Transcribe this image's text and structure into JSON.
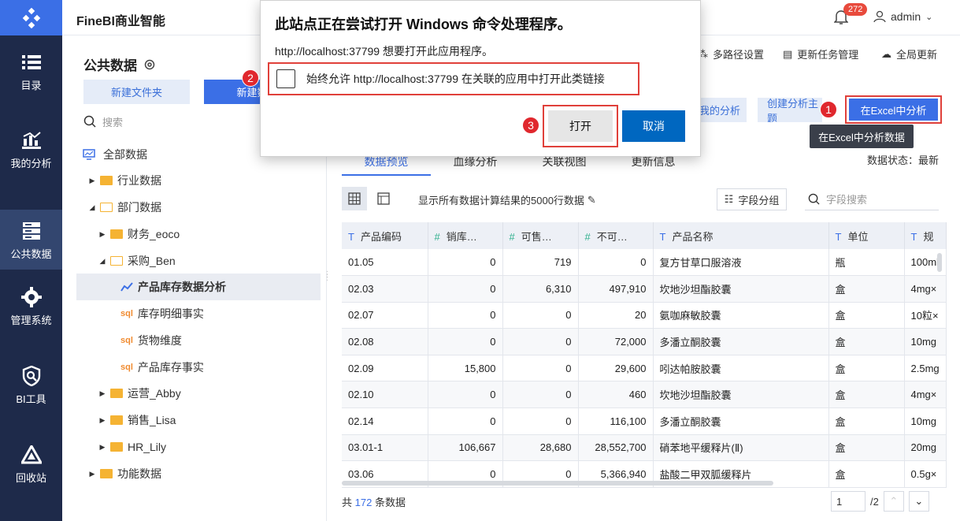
{
  "app": {
    "name": "FineBI商业智能",
    "notifications": "272",
    "user": "admin"
  },
  "nav": [
    {
      "label": "目录",
      "icon": "list-icon"
    },
    {
      "label": "我的分析",
      "icon": "chart-icon"
    },
    {
      "label": "公共数据",
      "icon": "database-icon"
    },
    {
      "label": "管理系统",
      "icon": "gear-icon"
    },
    {
      "label": "BI工具",
      "icon": "tools-icon"
    },
    {
      "label": "回收站",
      "icon": "recycle-icon"
    }
  ],
  "left": {
    "title": "公共数据",
    "new_folder": "新建文件夹",
    "new_data": "新建数据",
    "search_placeholder": "搜索",
    "tree": [
      {
        "label": "全部数据"
      },
      {
        "label": "行业数据"
      },
      {
        "label": "部门数据"
      },
      {
        "label": "财务_eoco"
      },
      {
        "label": "采购_Ben"
      },
      {
        "label": "产品库存数据分析"
      },
      {
        "label": "库存明细事实"
      },
      {
        "label": "货物维度"
      },
      {
        "label": "产品库存事实"
      },
      {
        "label": "运营_Abby"
      },
      {
        "label": "销售_Lisa"
      },
      {
        "label": "HR_Lily"
      },
      {
        "label": "功能数据"
      }
    ]
  },
  "toolbar": {
    "multi_path": "多路径设置",
    "update_task": "更新任务管理",
    "global_update": "全局更新"
  },
  "actions": {
    "my_analysis": "我的分析",
    "create_subject": "创建分析主题",
    "excel": "在Excel中分析",
    "excel_tooltip": "在Excel中分析数据"
  },
  "tabs": [
    "数据预览",
    "血缘分析",
    "关联视图",
    "更新信息"
  ],
  "status": "数据状态：最新",
  "calc_text": "显示所有数据计算结果的5000行数据",
  "field_group": "字段分组",
  "field_search_placeholder": "字段搜索",
  "table": {
    "headers": [
      "产品编码",
      "销库…",
      "可售…",
      "不可…",
      "产品名称",
      "单位",
      "规"
    ],
    "rows": [
      [
        "01.05",
        "0",
        "719",
        "0",
        "复方甘草口服溶液",
        "瓶",
        "100ml"
      ],
      [
        "02.03",
        "0",
        "6,310",
        "497,910",
        "坎地沙坦酯胶囊",
        "盒",
        "4mg×"
      ],
      [
        "02.07",
        "0",
        "0",
        "20",
        "氨咖麻敏胶囊",
        "盒",
        "10粒×"
      ],
      [
        "02.08",
        "0",
        "0",
        "72,000",
        "多潘立酮胶囊",
        "盒",
        "10mg"
      ],
      [
        "02.09",
        "15,800",
        "0",
        "29,600",
        "吲达帕胺胶囊",
        "盒",
        "2.5mg"
      ],
      [
        "02.10",
        "0",
        "0",
        "460",
        "坎地沙坦酯胶囊",
        "盒",
        "4mg×"
      ],
      [
        "02.14",
        "0",
        "0",
        "116,100",
        "多潘立酮胶囊",
        "盒",
        "10mg"
      ],
      [
        "03.01-1",
        "106,667",
        "28,680",
        "28,552,700",
        "硝苯地平缓释片(Ⅱ)",
        "盒",
        "20mg"
      ],
      [
        "03.06",
        "0",
        "0",
        "5,366,940",
        "盐酸二甲双胍缓释片",
        "盒",
        "0.5g×"
      ]
    ]
  },
  "footer": {
    "prefix": "共",
    "count": "172",
    "suffix": "条数据"
  },
  "pager": {
    "page": "1",
    "total": "/2"
  },
  "dialog": {
    "title": "此站点正在尝试打开 Windows 命令处理程序。",
    "message": "http://localhost:37799 想要打开此应用程序。",
    "checkbox_label": "始终允许 http://localhost:37799 在关联的应用中打开此类链接",
    "open": "打开",
    "cancel": "取消"
  },
  "markers": [
    "1",
    "2",
    "3"
  ]
}
